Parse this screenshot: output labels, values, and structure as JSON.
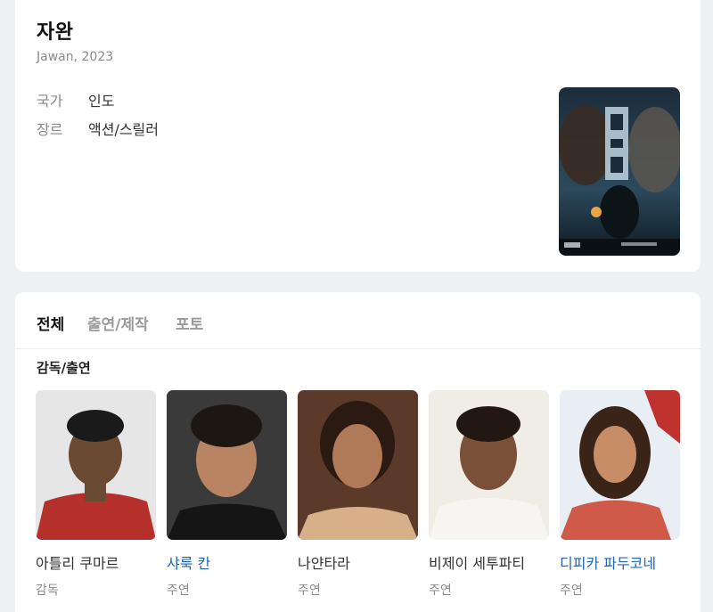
{
  "movie": {
    "title": "자완",
    "subtitle": "Jawan, 2023",
    "country_label": "국가",
    "country_value": "인도",
    "genre_label": "장르",
    "genre_value": "액션/스릴러"
  },
  "tabs": [
    {
      "label": "전체",
      "active": true
    },
    {
      "label": "출연/제작",
      "active": false
    },
    {
      "label": "포토",
      "active": false
    }
  ],
  "section_title": "감독/출연",
  "people": [
    {
      "name": "아틀리 쿠마르",
      "role": "감독",
      "link": false
    },
    {
      "name": "샤룩 칸",
      "role": "주연",
      "link": true
    },
    {
      "name": "나얀타라",
      "role": "주연",
      "link": false
    },
    {
      "name": "비제이 세투파티",
      "role": "주연",
      "link": false
    },
    {
      "name": "디피카 파두코네",
      "role": "주연",
      "link": true
    }
  ],
  "colors": {
    "page_bg": "#eef0f4",
    "link_blue": "#1e63b8",
    "muted_gray": "#8a8a8a"
  }
}
